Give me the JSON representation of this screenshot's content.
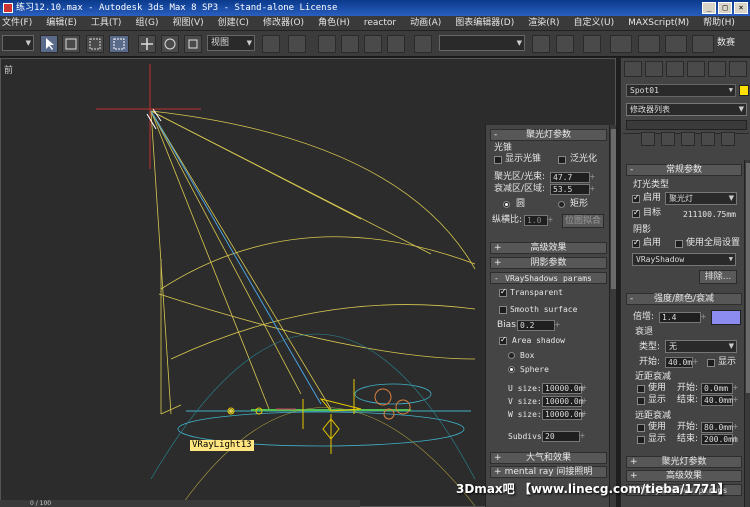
{
  "window": {
    "title": "练习12.10.max - Autodesk 3ds Max 8 SP3 - Stand-alone License",
    "buttons": [
      "_",
      "□",
      "×"
    ]
  },
  "menu": [
    "文件(F)",
    "编辑(E)",
    "工具(T)",
    "组(G)",
    "视图(V)",
    "创建(C)",
    "修改器(O)",
    "角色(H)",
    "reactor",
    "动画(A)",
    "图表编辑器(D)",
    "渲染(R)",
    "自定义(U)",
    "MAXScript(M)",
    "帮助(H)"
  ],
  "toolbar": {
    "view_dropdown": "视图",
    "right_label": "数赛"
  },
  "viewport": {
    "label": "前",
    "light_label": "VRayLight13"
  },
  "spot": {
    "title": "聚光灯参数",
    "group": "光锥",
    "show_cone": "显示光锥",
    "overshoot": "泛光化",
    "hotspot_label": "聚光区/光束:",
    "hotspot": "47.7",
    "falloff_label": "衰减区/区域:",
    "falloff": "53.5",
    "circle": "圆",
    "rect": "矩形",
    "aspect_label": "纵横比:",
    "aspect": "1.0",
    "bitmap_fit": "位图拟合"
  },
  "rollouts": {
    "advanced": "高级效果",
    "shadow_params": "阴影参数",
    "vray_shadows": "VRayShadows params",
    "atmos": "大气和效果",
    "mental_ray": "mental ray 间接照明"
  },
  "vray": {
    "transparent": "Transparent",
    "smooth": "Smooth surface",
    "bias_label": "Bias:",
    "bias": "0.2",
    "area": "Area shadow",
    "box": "Box",
    "sphere": "Sphere",
    "u_label": "U size:",
    "u": "10000.0m",
    "v_label": "V size:",
    "v": "10000.0m",
    "w_label": "W size:",
    "w": "10000.0m",
    "subdivs_label": "Subdivs:",
    "subdivs": "20"
  },
  "cmd": {
    "object_name": "Spot01",
    "modifier_list": "修改器列表",
    "general_title": "常规参数",
    "light_type": "灯光类型",
    "on": "启用",
    "type": "聚光灯",
    "target": "目标",
    "target_dist": "211100.75mm",
    "shadows": "阴影",
    "shadow_on": "启用",
    "global": "使用全局设置",
    "shadow_type": "VRayShadow",
    "exclude": "排除...",
    "intensity_title": "强度/颜色/衰减",
    "multiplier_label": "倍增:",
    "multiplier": "1.4",
    "decay": "衰退",
    "decay_type_label": "类型:",
    "decay_type": "无",
    "start_label": "开始:",
    "start": "40.0m",
    "show": "显示",
    "near": "近距衰减",
    "use": "使用",
    "near_start": "0.0mm",
    "near_end": "40.0mm",
    "start2": "开始:",
    "end": "结束:",
    "far": "远距衰减",
    "far_start": "80.0mm",
    "far_end": "200.0mm",
    "spot_title": "聚光灯参数",
    "adv_title": "高级效果",
    "vray_title": "VRayShadows params"
  },
  "status": {
    "frame": "0 / 100"
  },
  "watermark": "3Dmax吧 【www.linecg.com/tieba/1771】",
  "colors": {
    "light_swatch": "#ffe000",
    "multiplier_swatch": "#8c8cf0"
  }
}
